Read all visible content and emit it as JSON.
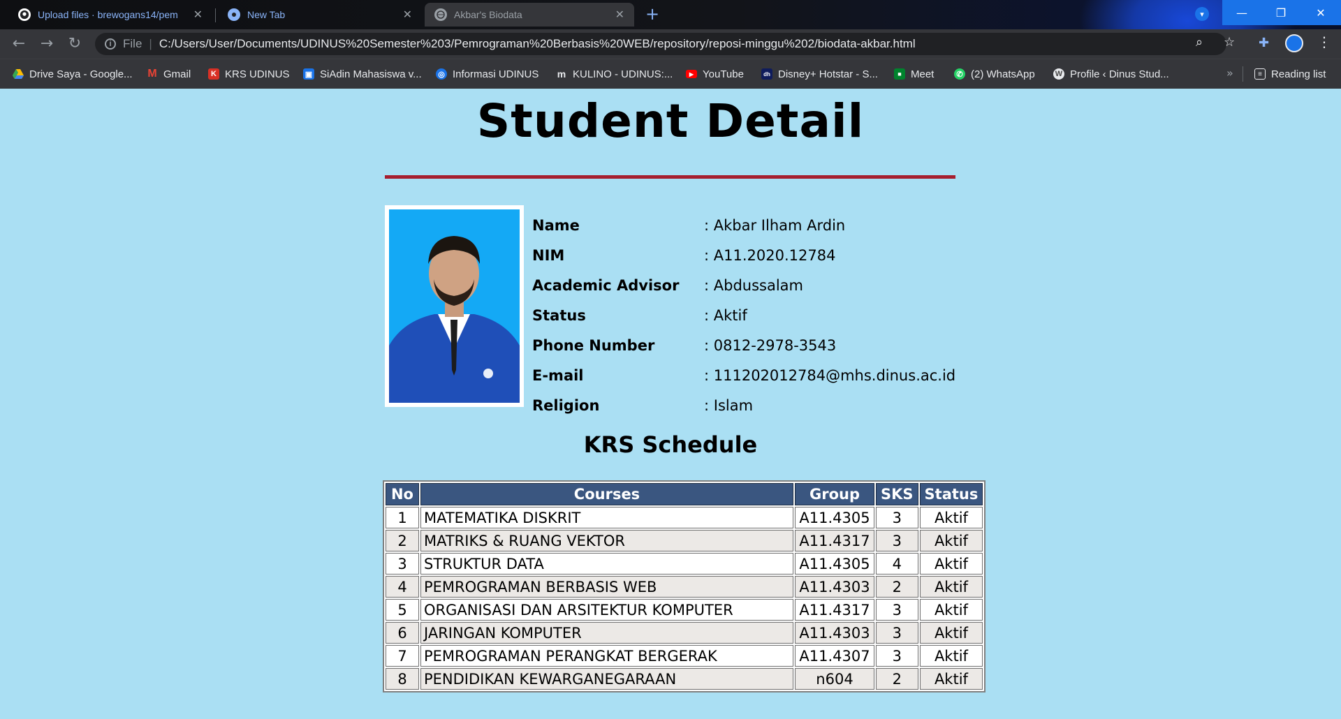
{
  "browser": {
    "tabs": [
      {
        "title": "Upload files · brewogans14/pem",
        "icon": "github-icon",
        "active": false
      },
      {
        "title": "New Tab",
        "icon": "chrome-icon",
        "active": false
      },
      {
        "title": "Akbar's Biodata",
        "icon": "globe-icon",
        "active": true
      }
    ],
    "omnibox": {
      "scheme": "File",
      "url": "C:/Users/User/Documents/UDINUS%20Semester%203/Pemrograman%20Berbasis%20WEB/repository/reposi-minggu%202/biodata-akbar.html"
    },
    "bookmarks": [
      {
        "label": "Drive Saya - Google...",
        "icon": "drive-icon",
        "color": "#34a853"
      },
      {
        "label": "Gmail",
        "icon": "gmail-icon",
        "color": "#ea4335"
      },
      {
        "label": "KRS UDINUS",
        "icon": "k-icon",
        "color": "#d93025"
      },
      {
        "label": "SiAdin Mahasiswa v...",
        "icon": "siadin-icon",
        "color": "#1a73e8"
      },
      {
        "label": "Informasi UDINUS",
        "icon": "globe-icon",
        "color": "#1a73e8"
      },
      {
        "label": "KULINO - UDINUS:...",
        "icon": "moodle-icon",
        "color": "#5f6368"
      },
      {
        "label": "YouTube",
        "icon": "youtube-icon",
        "color": "#ff0000"
      },
      {
        "label": "Disney+ Hotstar - S...",
        "icon": "hotstar-icon",
        "color": "#0f1c5c"
      },
      {
        "label": "Meet",
        "icon": "meet-icon",
        "color": "#00832d"
      },
      {
        "label": "(2) WhatsApp",
        "icon": "whatsapp-icon",
        "color": "#25d366"
      },
      {
        "label": "Profile ‹ Dinus Stud...",
        "icon": "wordpress-icon",
        "color": "#464646"
      }
    ],
    "more_bookmarks": "»",
    "reading_list": "Reading list"
  },
  "page": {
    "title": "Student Detail",
    "info": [
      {
        "label": "Name",
        "value": ": Akbar Ilham Ardin"
      },
      {
        "label": "NIM",
        "value": ": A11.2020.12784"
      },
      {
        "label": "Academic Advisor",
        "value": ": Abdussalam"
      },
      {
        "label": "Status",
        "value": ": Aktif"
      },
      {
        "label": "Phone Number",
        "value": ": 0812-2978-3543"
      },
      {
        "label": "E-mail",
        "value": ": 111202012784@mhs.dinus.ac.id"
      },
      {
        "label": "Religion",
        "value": ": Islam"
      }
    ],
    "krs_title": "KRS Schedule",
    "krs_headers": [
      "No",
      "Courses",
      "Group",
      "SKS",
      "Status"
    ],
    "krs_rows": [
      [
        "1",
        "MATEMATIKA DISKRIT",
        "A11.4305",
        "3",
        "Aktif"
      ],
      [
        "2",
        "MATRIKS & RUANG VEKTOR",
        "A11.4317",
        "3",
        "Aktif"
      ],
      [
        "3",
        "STRUKTUR DATA",
        "A11.4305",
        "4",
        "Aktif"
      ],
      [
        "4",
        "PEMROGRAMAN BERBASIS WEB",
        "A11.4303",
        "2",
        "Aktif"
      ],
      [
        "5",
        "ORGANISASI DAN ARSITEKTUR KOMPUTER",
        "A11.4317",
        "3",
        "Aktif"
      ],
      [
        "6",
        "JARINGAN KOMPUTER",
        "A11.4303",
        "3",
        "Aktif"
      ],
      [
        "7",
        "PEMROGRAMAN PERANGKAT BERGERAK",
        "A11.4307",
        "3",
        "Aktif"
      ],
      [
        "8",
        "PENDIDIKAN KEWARGANEGARAAN",
        "n604",
        "2",
        "Aktif"
      ]
    ]
  }
}
